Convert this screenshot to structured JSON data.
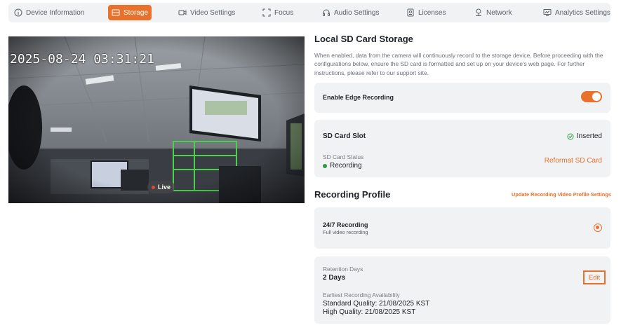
{
  "tabs": [
    {
      "label": "Device Information",
      "icon": "info-icon",
      "active": false
    },
    {
      "label": "Storage",
      "icon": "storage-icon",
      "active": true
    },
    {
      "label": "Video Settings",
      "icon": "video-camera-icon",
      "active": false
    },
    {
      "label": "Focus",
      "icon": "focus-icon",
      "active": false
    },
    {
      "label": "Audio Settings",
      "icon": "headphones-icon",
      "active": false
    },
    {
      "label": "Licenses",
      "icon": "license-icon",
      "active": false
    },
    {
      "label": "Network",
      "icon": "network-icon",
      "active": false
    },
    {
      "label": "Analytics Settings",
      "icon": "analytics-icon",
      "active": false
    }
  ],
  "video": {
    "timestamp": "2025-08-24 03:31:21",
    "live_label": "Live"
  },
  "storage": {
    "title": "Local SD Card Storage",
    "description": "When enabled, data from the camera will continuously record to the storage device. Before proceeding with the configurations below, ensure the SD card is formatted and set up on your device's web page. For further instructions, please refer to our support site.",
    "edge_recording": {
      "label": "Enable Edge Recording",
      "enabled": true
    },
    "sd_card": {
      "slot_label": "SD Card Slot",
      "slot_status": "Inserted",
      "status_label": "SD Card Status",
      "status_value": "Recording",
      "reformat_label": "Reformat SD Card"
    }
  },
  "recording_profile": {
    "title": "Recording Profile",
    "update_link": "Update Recording Video Profile Settings",
    "option": {
      "title": "24/7 Recording",
      "subtitle": "Full video recording",
      "selected": true
    },
    "retention": {
      "label": "Retention Days",
      "value": "2 Days",
      "edit_label": "Edit",
      "earliest_label": "Earliest Recording Availability",
      "standard_quality": "Standard Quality: 21/08/2025 KST",
      "high_quality": "High Quality: 21/08/2025 KST"
    }
  },
  "colors": {
    "accent": "#e8712b",
    "status_green": "#2e9b3e",
    "card_bg": "#f1f2f4"
  }
}
